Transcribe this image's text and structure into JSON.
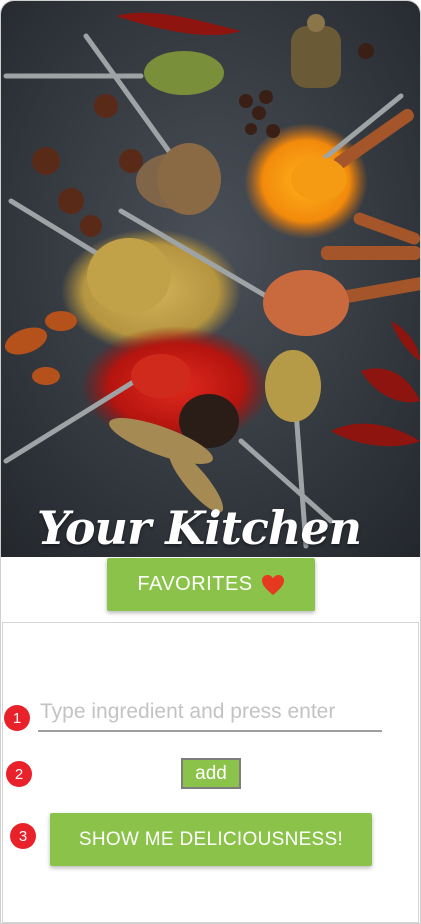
{
  "hero": {
    "title": "Your Kitchen",
    "image_icon": "spices-photo"
  },
  "favorites": {
    "label": "FAVORITES",
    "icon": "heart-icon",
    "icon_color": "#e53920"
  },
  "form": {
    "ingredient_placeholder": "Type ingredient and press enter",
    "add_label": "add",
    "submit_label": "SHOW ME DELICIOUSNESS!"
  },
  "annotations": [
    "1",
    "2",
    "3"
  ],
  "colors": {
    "accent": "#8bc34a",
    "badge": "#e8212a",
    "white": "#ffffff"
  }
}
